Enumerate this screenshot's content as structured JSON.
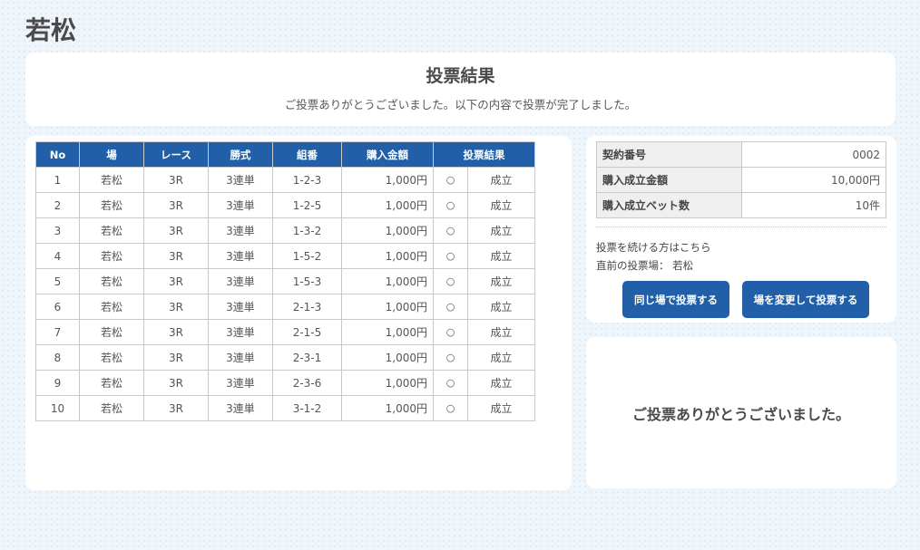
{
  "page": {
    "title": "若松"
  },
  "header": {
    "title": "投票結果",
    "message": "ご投票ありがとうございました。以下の内容で投票が完了しました。"
  },
  "bets": {
    "columns": [
      "No",
      "場",
      "レース",
      "勝式",
      "組番",
      "購入金額",
      "投票結果"
    ],
    "rows": [
      {
        "no": "1",
        "venue": "若松",
        "race": "3R",
        "type": "3連単",
        "combo": "1-2-3",
        "amount": "1,000円",
        "mark": "○",
        "result": "成立"
      },
      {
        "no": "2",
        "venue": "若松",
        "race": "3R",
        "type": "3連単",
        "combo": "1-2-5",
        "amount": "1,000円",
        "mark": "○",
        "result": "成立"
      },
      {
        "no": "3",
        "venue": "若松",
        "race": "3R",
        "type": "3連単",
        "combo": "1-3-2",
        "amount": "1,000円",
        "mark": "○",
        "result": "成立"
      },
      {
        "no": "4",
        "venue": "若松",
        "race": "3R",
        "type": "3連単",
        "combo": "1-5-2",
        "amount": "1,000円",
        "mark": "○",
        "result": "成立"
      },
      {
        "no": "5",
        "venue": "若松",
        "race": "3R",
        "type": "3連単",
        "combo": "1-5-3",
        "amount": "1,000円",
        "mark": "○",
        "result": "成立"
      },
      {
        "no": "6",
        "venue": "若松",
        "race": "3R",
        "type": "3連単",
        "combo": "2-1-3",
        "amount": "1,000円",
        "mark": "○",
        "result": "成立"
      },
      {
        "no": "7",
        "venue": "若松",
        "race": "3R",
        "type": "3連単",
        "combo": "2-1-5",
        "amount": "1,000円",
        "mark": "○",
        "result": "成立"
      },
      {
        "no": "8",
        "venue": "若松",
        "race": "3R",
        "type": "3連単",
        "combo": "2-3-1",
        "amount": "1,000円",
        "mark": "○",
        "result": "成立"
      },
      {
        "no": "9",
        "venue": "若松",
        "race": "3R",
        "type": "3連単",
        "combo": "2-3-6",
        "amount": "1,000円",
        "mark": "○",
        "result": "成立"
      },
      {
        "no": "10",
        "venue": "若松",
        "race": "3R",
        "type": "3連単",
        "combo": "3-1-2",
        "amount": "1,000円",
        "mark": "○",
        "result": "成立"
      }
    ]
  },
  "summary": {
    "rows": [
      {
        "label": "契約番号",
        "value": "0002"
      },
      {
        "label": "購入成立金額",
        "value": "10,000円"
      },
      {
        "label": "購入成立ベット数",
        "value": "10件"
      }
    ],
    "continue_text": "投票を続ける方はこちら",
    "last_venue_label": "直前の投票場：",
    "last_venue": "若松",
    "same_venue_button": "同じ場で投票する",
    "change_venue_button": "場を変更して投票する"
  },
  "thanks": {
    "message": "ご投票ありがとうございました。"
  },
  "colors": {
    "accent": "#2160a8",
    "background": "#eef5fb"
  }
}
